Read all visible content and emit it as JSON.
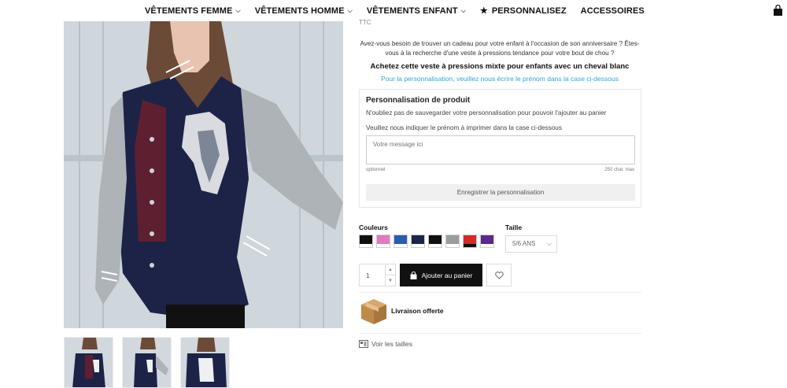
{
  "nav": {
    "items": [
      {
        "label": "VÊTEMENTS FEMME",
        "has_chevron": true
      },
      {
        "label": "VÊTEMENTS HOMME",
        "has_chevron": true
      },
      {
        "label": "VÊTEMENTS ENFANT",
        "has_chevron": true
      },
      {
        "label": "PERSONNALISEZ",
        "has_star": true
      },
      {
        "label": "ACCESSOIRES"
      }
    ],
    "cart_icon": "shopping-bag-icon"
  },
  "product": {
    "ttc": "TTC",
    "intro": "Avez-vous besoin de trouver un cadeau pour votre enfant à l'occasion de son anniversaire ? Êtes-vous à la recherche d'une veste à pressions tendance pour votre bout de chou ?",
    "headline": "Achetez cette veste à pressions mixte pour enfants avec un cheval blanc",
    "perso_link": "Pour la personnalisation, veuillez nous écrire le prénom dans la case ci-dessous"
  },
  "personalization": {
    "title": "Personnalisation de produit",
    "note": "N'oubliez pas de sauvegarder votre personnalisation pour pouvoir l'ajouter au panier",
    "question": "Veuillez nous indiquer le prénom à imprimer dans la case ci-dessous",
    "placeholder": "Votre message ici",
    "optional": "optionnel",
    "max": "250 char. max",
    "save_button": "Enregistrer la personnalisation"
  },
  "options": {
    "colors_label": "Couleurs",
    "size_label": "Taille",
    "size_value": "5/6 ANS",
    "swatches": [
      {
        "top": "#111111",
        "bottom": "#ffffff"
      },
      {
        "top": "#e07bbd",
        "bottom": "#ffffff"
      },
      {
        "top": "#2a5db0",
        "bottom": "#ffffff"
      },
      {
        "top": "#1b2547",
        "bottom": "#ffffff"
      },
      {
        "top": "#111111",
        "bottom": "#ffffff"
      },
      {
        "top": "#9c9c9c",
        "bottom": "#ffffff"
      },
      {
        "top": "#d42b2b",
        "bottom": "#111111"
      },
      {
        "top": "#5b2a8c",
        "bottom": "#ffffff"
      }
    ]
  },
  "cart": {
    "quantity": "1",
    "add_label": "Ajouter au panier"
  },
  "shipping": {
    "label": "Livraison offerte"
  },
  "sizes": {
    "label": "Voir les tailles"
  }
}
